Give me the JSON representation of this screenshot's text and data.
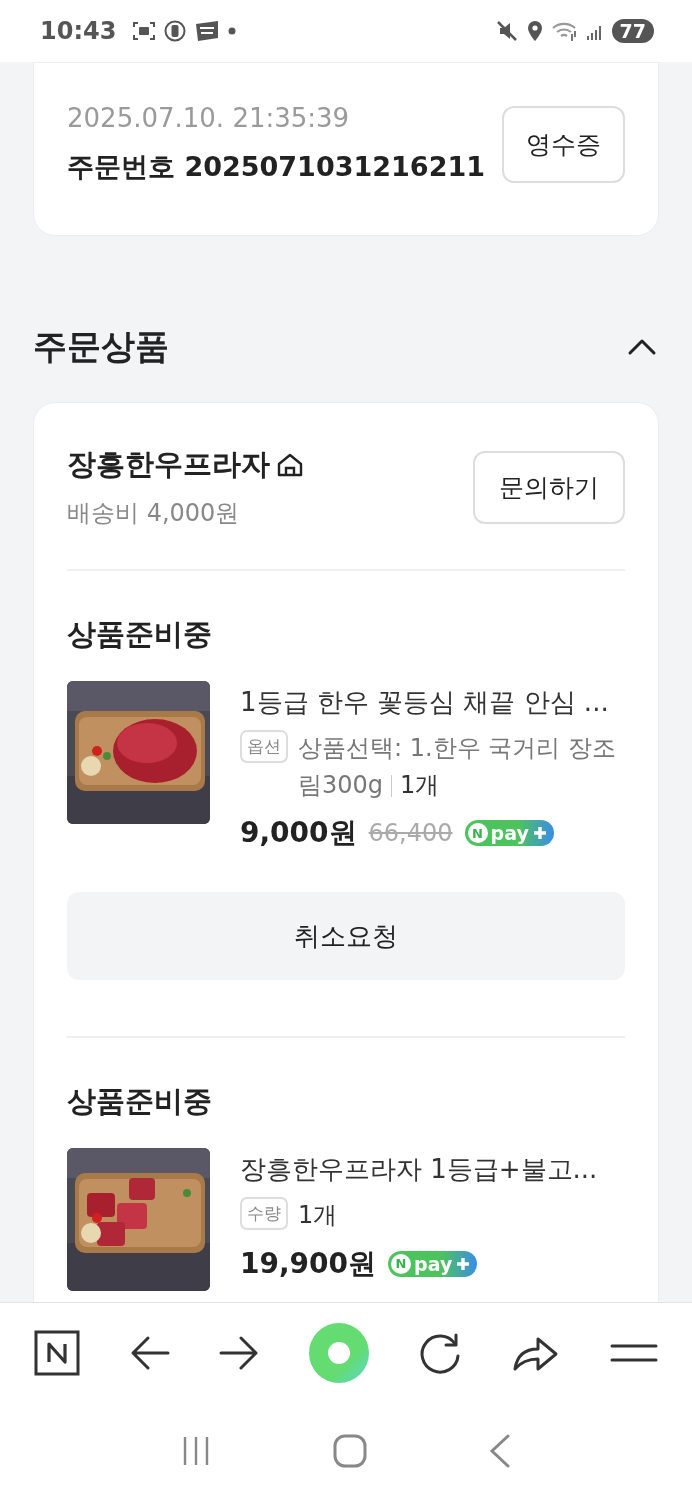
{
  "status_bar": {
    "time": "10:43",
    "battery": "77"
  },
  "order": {
    "datetime": "2025.07.10. 21:35:39",
    "order_number": "주문번호 2025071031216211",
    "receipt_button": "영수증"
  },
  "section": {
    "title": "주문상품",
    "expanded": true
  },
  "store": {
    "name": "장흥한우프라자",
    "shipping": "배송비 4,000원",
    "inquiry_button": "문의하기"
  },
  "groups": [
    {
      "status": "상품준비중",
      "item": {
        "title": "1등급 한우 꽃등심 채끝 안심 ...",
        "tag": "옵션",
        "option": "상품선택: 1.한우 국거리 장조림300g",
        "quantity": "1개",
        "price": "9,000원",
        "original_price": "66,400",
        "npay": {
          "mark": "N",
          "label": "pay"
        }
      },
      "action": "취소요청"
    },
    {
      "status": "상품준비중",
      "item": {
        "title": "장흥한우프라자 1등급+불고...",
        "tag": "수량",
        "quantity": "1개",
        "price": "19,900원",
        "npay": {
          "mark": "N",
          "label": "pay"
        }
      }
    }
  ]
}
